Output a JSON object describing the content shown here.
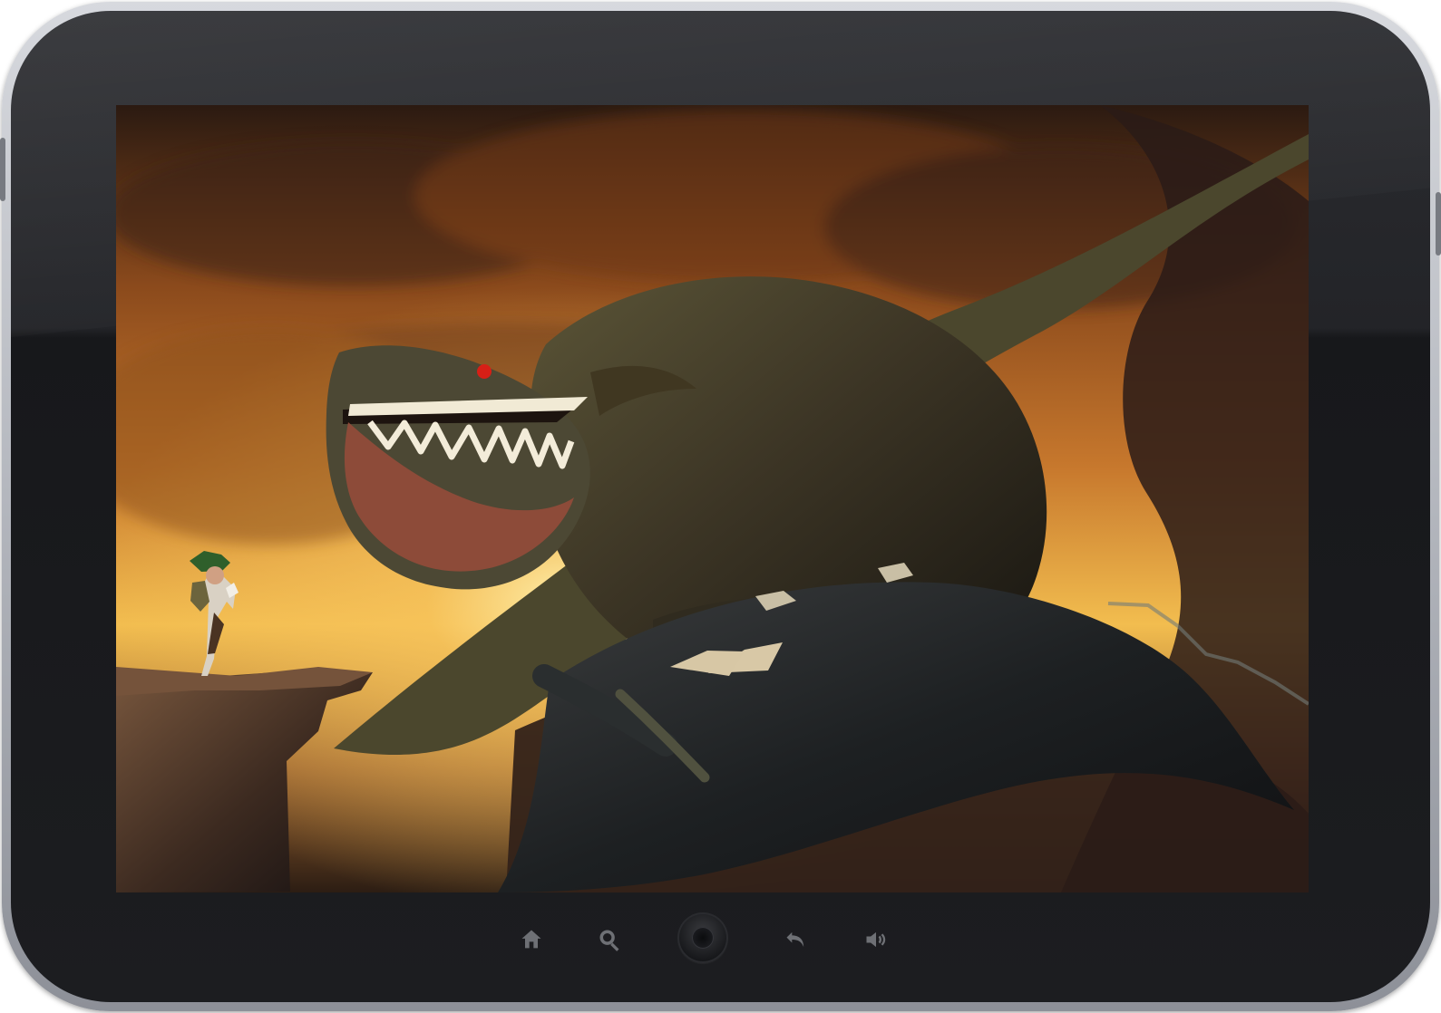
{
  "device": {
    "screen_content": "fantasy-dragon-artwork",
    "frame_color": "#1f2024",
    "accent_color": "#6e7075"
  },
  "navigation": {
    "buttons": [
      {
        "name": "home-icon",
        "action": "home"
      },
      {
        "name": "search-icon",
        "action": "search"
      },
      {
        "name": "physical-home-button",
        "action": "home"
      },
      {
        "name": "back-icon",
        "action": "back"
      },
      {
        "name": "volume-icon",
        "action": "volume"
      }
    ]
  }
}
